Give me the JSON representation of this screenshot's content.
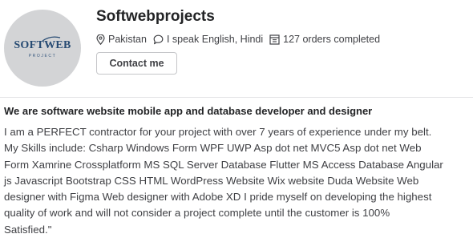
{
  "profile": {
    "name": "Softwebprojects",
    "avatar": {
      "logo_text": "SOFTWEB",
      "logo_subtext": "PROJECT",
      "background_color": "#d3d4d6",
      "logo_color": "#274b73"
    },
    "meta": [
      {
        "icon": "location-pin-icon",
        "text": "Pakistan"
      },
      {
        "icon": "speech-bubble-icon",
        "text": "I speak English, Hindi"
      },
      {
        "icon": "orders-icon",
        "text": "127 orders completed"
      }
    ],
    "contact_label": "Contact me"
  },
  "about": {
    "title": "We are software website mobile app and database developer and designer",
    "lines": [
      "I am a PERFECT contractor for your project with over 7 years of experience under my belt.",
      "My Skills include: Csharp Windows Form WPF UWP Asp dot net MVC5 Asp dot net Web",
      "Form Xamrine Crossplatform MS SQL Server Database Flutter MS Access Database Angular",
      "js Javascript Bootstrap CSS HTML WordPress Website Wix website Duda Website Web",
      "designer with Figma Web designer with Adobe XD I pride myself on developing the highest",
      "quality of work and will not consider a project complete until the customer is 100%",
      "Satisfied.\""
    ]
  }
}
